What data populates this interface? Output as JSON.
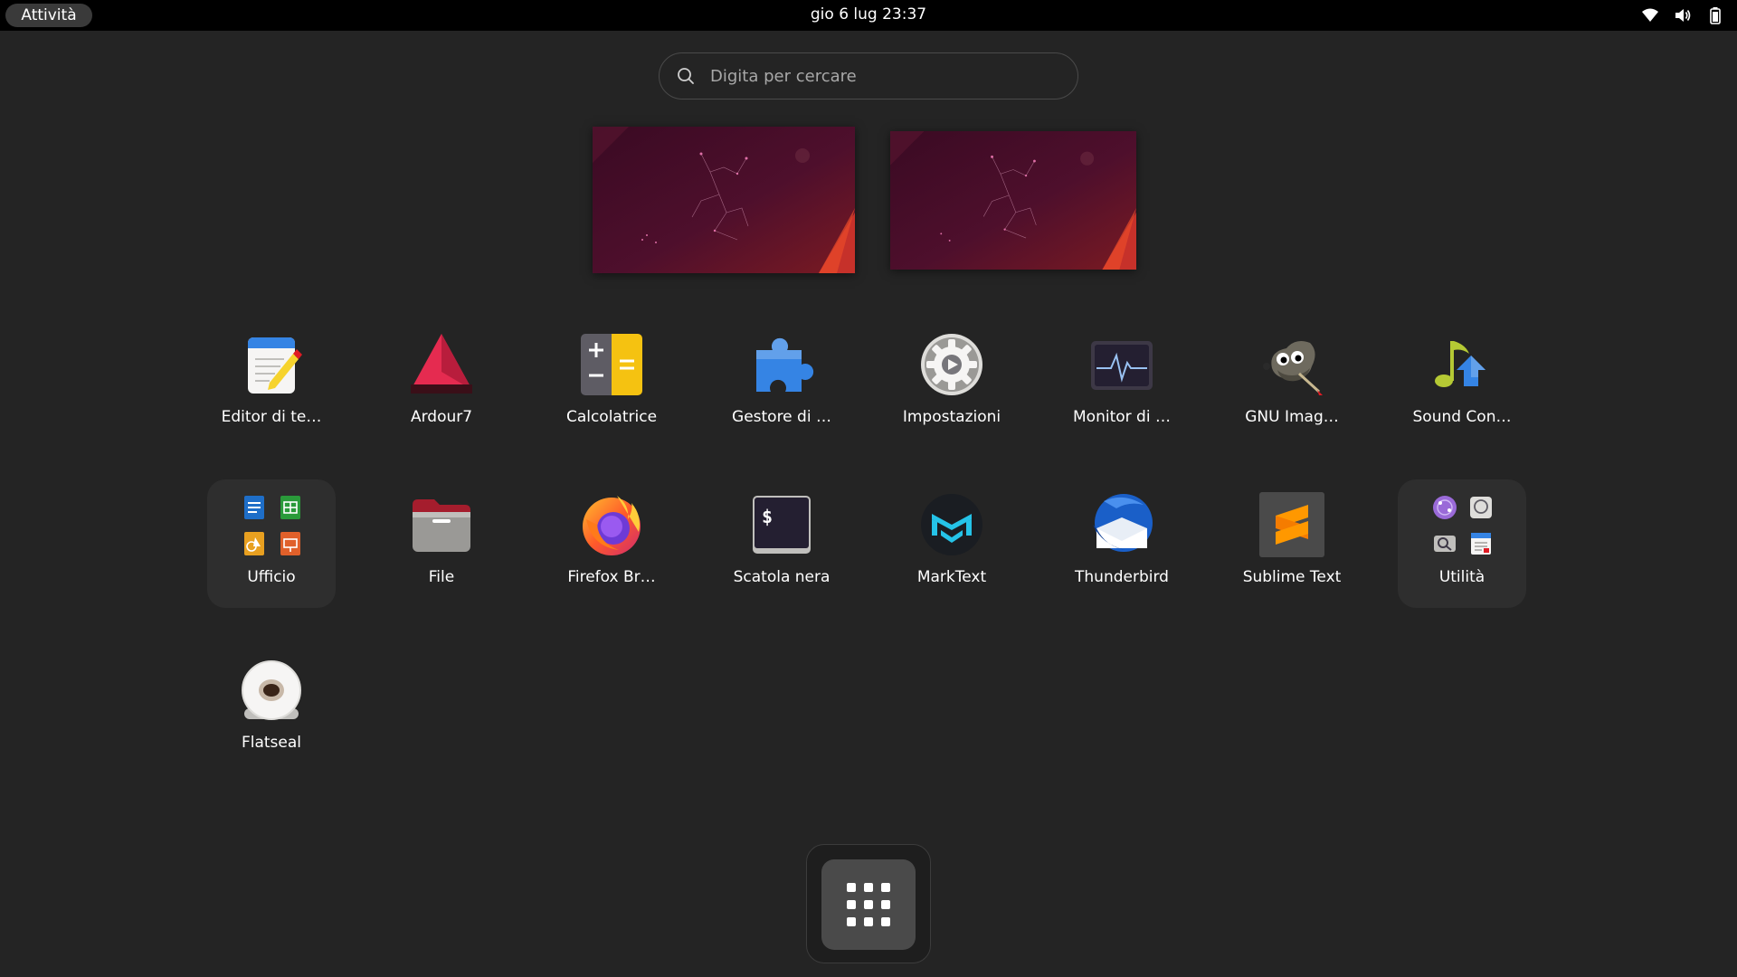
{
  "topbar": {
    "activities_label": "Attività",
    "clock": "gio 6 lug  23:37",
    "tray": [
      "wifi-icon",
      "volume-icon",
      "battery-icon"
    ]
  },
  "search": {
    "placeholder": "Digita per cercare",
    "value": ""
  },
  "workspaces": [
    {
      "name": "workspace-1"
    },
    {
      "name": "workspace-2"
    }
  ],
  "apps": {
    "row1": [
      {
        "label": "Editor di te…",
        "icon": "text-editor-icon"
      },
      {
        "label": "Ardour7",
        "icon": "ardour-icon"
      },
      {
        "label": "Calcolatrice",
        "icon": "calculator-icon"
      },
      {
        "label": "Gestore di …",
        "icon": "extension-manager-icon"
      },
      {
        "label": "Impostazioni",
        "icon": "settings-icon"
      },
      {
        "label": "Monitor di …",
        "icon": "system-monitor-icon"
      },
      {
        "label": "GNU Imag…",
        "icon": "gimp-icon"
      },
      {
        "label": "Sound Con…",
        "icon": "sound-converter-icon"
      }
    ],
    "row2": [
      {
        "label": "Ufficio",
        "icon": "office-folder-icon"
      },
      {
        "label": "File",
        "icon": "files-icon"
      },
      {
        "label": "Firefox Br…",
        "icon": "firefox-icon"
      },
      {
        "label": "Scatola nera",
        "icon": "terminal-icon"
      },
      {
        "label": "MarkText",
        "icon": "marktext-icon"
      },
      {
        "label": "Thunderbird",
        "icon": "thunderbird-icon"
      },
      {
        "label": "Sublime Text",
        "icon": "sublime-text-icon"
      },
      {
        "label": "Utilità",
        "icon": "utilities-folder-icon"
      }
    ],
    "row3": [
      {
        "label": "Flatseal",
        "icon": "flatseal-icon"
      }
    ]
  },
  "dock": {
    "show_apps_icon": "app-grid-icon"
  },
  "colors": {
    "background": "#242424",
    "topbar": "#000000",
    "folder_bg": "#2e2e2e",
    "accent_orange": "#e95420"
  }
}
